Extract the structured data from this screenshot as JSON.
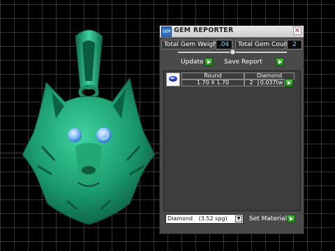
{
  "window": {
    "title": "GEM REPORTER",
    "icon": "gem-reporter-app-icon",
    "icon_text": "GEM",
    "close_glyph": "✕"
  },
  "totals": {
    "weight_label": "Total Gem Weight",
    "weight_value": ".04",
    "count_label": "Total Gem Count",
    "count_value": "2"
  },
  "buttons": {
    "update": "Update",
    "save_report": "Save Report",
    "set_material": "Set Material"
  },
  "gem_table": {
    "headers": {
      "cut": "Round",
      "material": "Diamond"
    },
    "rows": [
      {
        "size": "1.70 X 1.70",
        "count": "2",
        "weight": "0.037tw"
      }
    ]
  },
  "material_select": {
    "name": "Diamond",
    "spec": "(3.52 spg)",
    "dropdown_glyph": "▼"
  },
  "colors": {
    "model_green": "#1fa77a",
    "gem_blue": "#7fb8ff",
    "panel_bg": "#4a4a4a",
    "value_text": "#8fd3ff",
    "button_green": "#3fb82f"
  }
}
